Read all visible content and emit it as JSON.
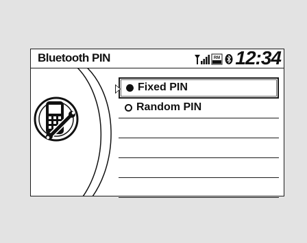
{
  "header": {
    "title": "Bluetooth PIN",
    "clock": "12:34"
  },
  "status_icons": [
    "signal-strength-icon",
    "roaming-icon",
    "bluetooth-icon"
  ],
  "status_roaming_text": "RM",
  "menu": {
    "options": [
      {
        "label": "Fixed PIN",
        "selected": true
      },
      {
        "label": "Random PIN",
        "selected": false
      }
    ],
    "empty_rows": 4
  },
  "colors": {
    "background": "#e3e3e3",
    "screen": "#ffffff",
    "ink": "#111111"
  }
}
